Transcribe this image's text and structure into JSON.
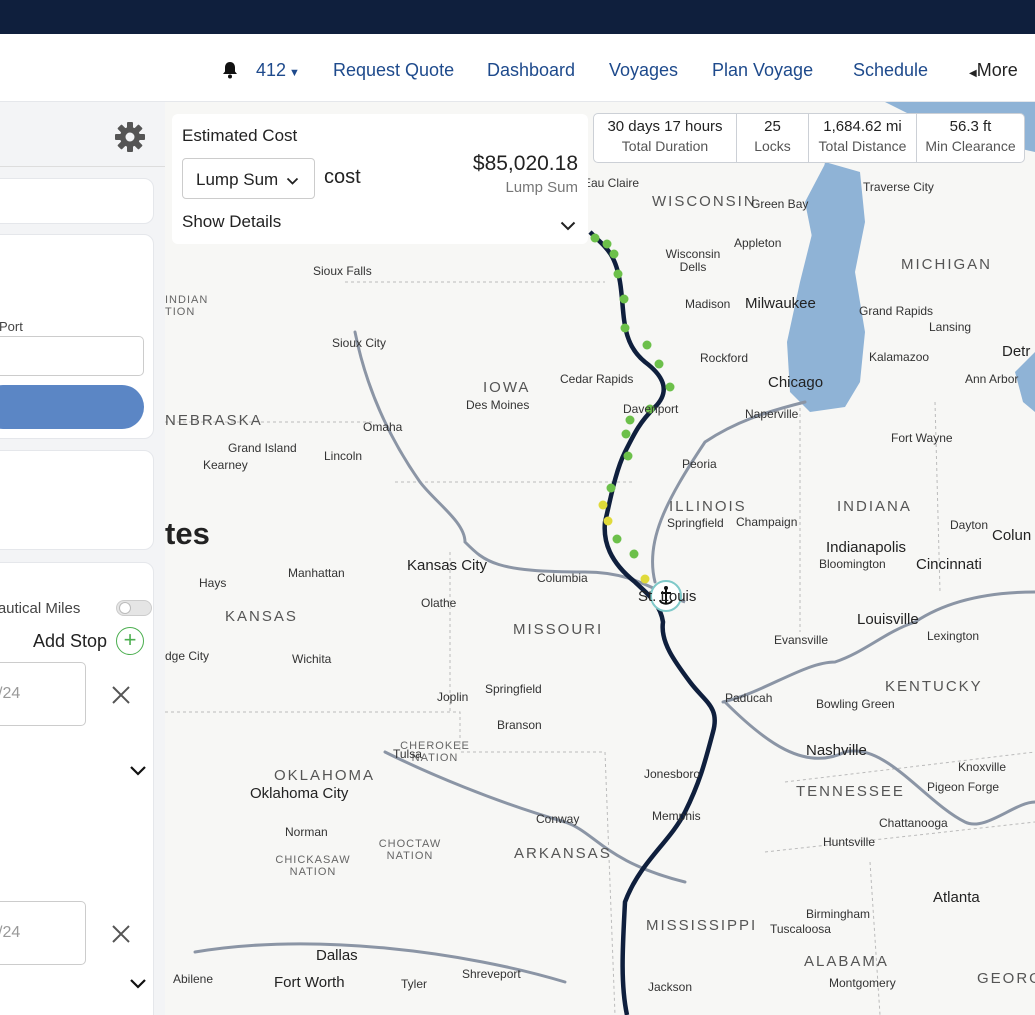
{
  "nav": {
    "notifications_count": "412",
    "items": [
      "Request Quote",
      "Dashboard",
      "Voyages",
      "Plan Voyage",
      "Schedule"
    ],
    "more_label": "More"
  },
  "sidebar": {
    "port_label": "Port",
    "nautical_miles_label": "Nautical Miles",
    "add_stop_label": "Add Stop",
    "stop_dates": [
      "/24",
      "/24"
    ]
  },
  "cost": {
    "title": "Estimated Cost",
    "type_select": "Lump Sum",
    "cost_suffix": "cost",
    "amount": "$85,020.18",
    "amount_sub": "Lump Sum",
    "details_label": "Show Details"
  },
  "stats": [
    {
      "value": "30 days 17 hours",
      "label": "Total Duration"
    },
    {
      "value": "25",
      "label": "Locks"
    },
    {
      "value": "1,684.62 mi",
      "label": "Total Distance"
    },
    {
      "value": "56.3 ft",
      "label": "Min Clearance"
    }
  ],
  "map": {
    "states": [
      "WISCONSIN",
      "MICHIGAN",
      "IOWA",
      "NEBRASKA",
      "ILLINOIS",
      "INDIANA",
      "KANSAS",
      "MISSOURI",
      "KENTUCKY",
      "OKLAHOMA",
      "TENNESSEE",
      "ARKANSAS",
      "MISSISSIPPI",
      "ALABAMA",
      "GEORG",
      "CHEROKEE NATION",
      "CHOCTAW NATION",
      "CHICKASAW NATION",
      "INDIAN TION"
    ],
    "country_fragment": "tes",
    "cities": [
      "Eau Claire",
      "Green Bay",
      "Traverse City",
      "Appleton",
      "Wisconsin Dells",
      "Sioux Falls",
      "Madison",
      "Milwaukee",
      "Grand Rapids",
      "Lansing",
      "Detr",
      "Sioux City",
      "Rockford",
      "Kalamazoo",
      "Ann Arbor",
      "Cedar Rapids",
      "Des Moines",
      "Davenport",
      "Chicago",
      "Naperville",
      "Omaha",
      "Grand Island",
      "Kearney",
      "Lincoln",
      "Fort Wayne",
      "Peoria",
      "Springfield",
      "Champaign",
      "Dayton",
      "Colun",
      "Indianapolis",
      "Bloomington",
      "Cincinnati",
      "Kansas City",
      "Hays",
      "Manhattan",
      "Olathe",
      "Columbia",
      "St. Louis",
      "Louisville",
      "Lexington",
      "Evansville",
      "Wichita",
      "dge City",
      "Joplin",
      "Springfield",
      "Paducah",
      "Bowling Green",
      "Branson",
      "Tulsa",
      "Nashville",
      "Knoxville",
      "Jonesboro",
      "Pigeon Forge",
      "Oklahoma City",
      "Norman",
      "Conway",
      "Memphis",
      "Chattanooga",
      "Huntsville",
      "Atlanta",
      "Birmingham",
      "Tuscaloosa",
      "Dallas",
      "Fort Worth",
      "Abilene",
      "Tyler",
      "Shreveport",
      "Jackson",
      "Montgomery"
    ]
  },
  "colors": {
    "topbar": "#0f1f3d",
    "route": "#0f1f3d",
    "lock": "#6cc04a",
    "lock_alt": "#e0da3a",
    "accent": "#5b86c5"
  }
}
